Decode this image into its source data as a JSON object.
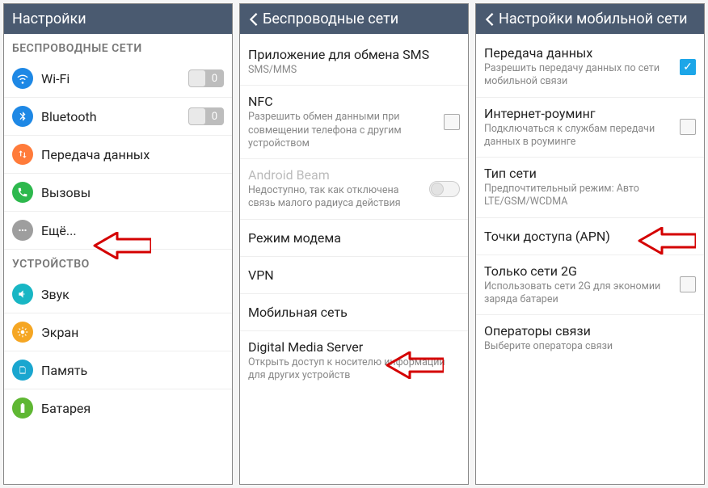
{
  "pane1": {
    "title": "Настройки",
    "section_wireless": "БЕСПРОВОДНЫЕ СЕТИ",
    "wifi": "Wi-Fi",
    "bluetooth": "Bluetooth",
    "data": "Передача данных",
    "calls": "Вызовы",
    "more": "Ещё...",
    "section_device": "УСТРОЙСТВО",
    "sound": "Звук",
    "display": "Экран",
    "memory": "Память",
    "battery": "Батарея"
  },
  "pane2": {
    "title": "Беспроводные сети",
    "sms_app": "Приложение для обмена SMS",
    "sms_app_sub": "SMS/MMS",
    "nfc": "NFC",
    "nfc_sub": "Разрешить обмен данными при совмещении телефона с другим устройством",
    "beam": "Android Beam",
    "beam_sub": "Недоступно, так как отключена связь малого радиуса действия",
    "tether": "Режим модема",
    "vpn": "VPN",
    "mobile": "Мобильная сеть",
    "dms": "Digital Media Server",
    "dms_sub": "Открыть доступ к носителю информации для других устройств"
  },
  "pane3": {
    "title": "Настройки мобильной сети",
    "data": "Передача данных",
    "data_sub": "Разрешить передачу данных по сети мобильной связи",
    "roaming": "Интернет-роуминг",
    "roaming_sub": "Подключаться к службам передачи данных в роуминге",
    "nettype": "Тип сети",
    "nettype_sub": "Предпочтительный режим: Авто LTE/GSM/WCDMA",
    "apn": "Точки доступа (APN)",
    "only2g": "Только сети 2G",
    "only2g_sub": "Использовать сети 2G для экономии заряда батареи",
    "operators": "Операторы связи",
    "operators_sub": "Выберите оператора связи"
  },
  "toggle_digit": "0",
  "checkmark": "✓"
}
